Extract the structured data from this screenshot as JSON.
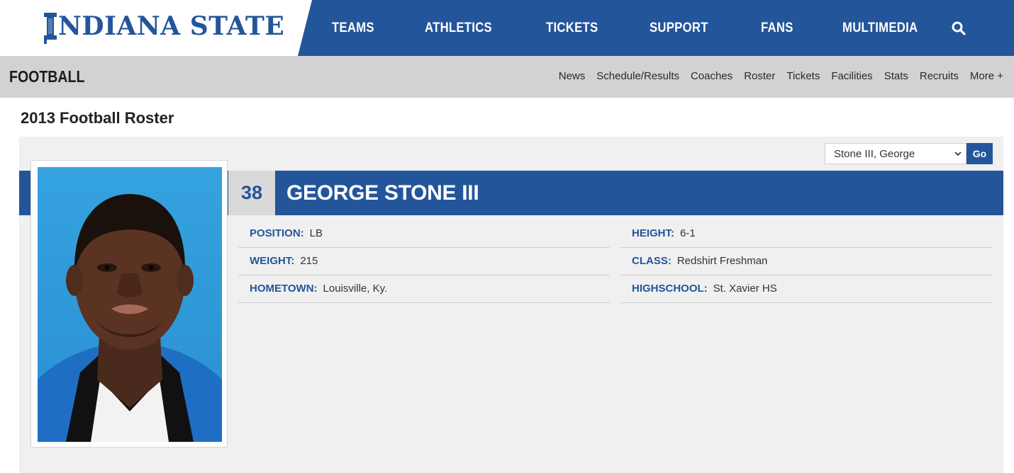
{
  "header": {
    "logo_text": "NDIANA STATE",
    "nav": [
      "TEAMS",
      "ATHLETICS",
      "TICKETS",
      "SUPPORT",
      "FANS",
      "MULTIMEDIA"
    ]
  },
  "subheader": {
    "sport": "FOOTBALL",
    "links": [
      "News",
      "Schedule/Results",
      "Coaches",
      "Roster",
      "Tickets",
      "Facilities",
      "Stats",
      "Recruits",
      "More +"
    ]
  },
  "page": {
    "title": "2013 Football Roster"
  },
  "selector": {
    "selected": "Stone III, George",
    "go_label": "Go"
  },
  "player": {
    "number": "38",
    "name": "GEORGE STONE III",
    "left_stats": [
      {
        "label": "POSITION:",
        "value": "LB"
      },
      {
        "label": "WEIGHT:",
        "value": "215"
      },
      {
        "label": "HOMETOWN:",
        "value": "Louisville, Ky."
      }
    ],
    "right_stats": [
      {
        "label": "HEIGHT:",
        "value": "6-1"
      },
      {
        "label": "CLASS:",
        "value": "Redshirt Freshman"
      },
      {
        "label": "HIGHSCHOOL:",
        "value": "St. Xavier HS"
      }
    ]
  },
  "colors": {
    "brand_blue": "#23559b",
    "subbar_gray": "#d2d2d2",
    "card_gray": "#f0f0f0",
    "photo_bg": "#2f9ad8"
  },
  "icons": {
    "search": "search-icon",
    "dropdown": "chevron-down-icon"
  }
}
